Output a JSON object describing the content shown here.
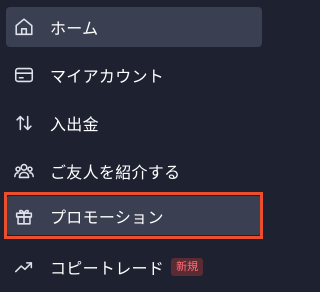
{
  "nav": {
    "items": [
      {
        "label": "ホーム",
        "icon": "home-icon"
      },
      {
        "label": "マイアカウント",
        "icon": "wallet-icon"
      },
      {
        "label": "入出金",
        "icon": "transfer-arrows-icon"
      },
      {
        "label": "ご友人を紹介する",
        "icon": "users-icon"
      },
      {
        "label": "プロモーション",
        "icon": "gift-icon"
      },
      {
        "label": "コピートレード",
        "icon": "trend-up-icon",
        "badge": "新規"
      }
    ]
  },
  "colors": {
    "background": "#1e2230",
    "active_item": "#3a3f52",
    "highlight_border": "#ea4e2c",
    "badge_bg": "#5a2b33",
    "badge_text": "#ff6d77"
  }
}
